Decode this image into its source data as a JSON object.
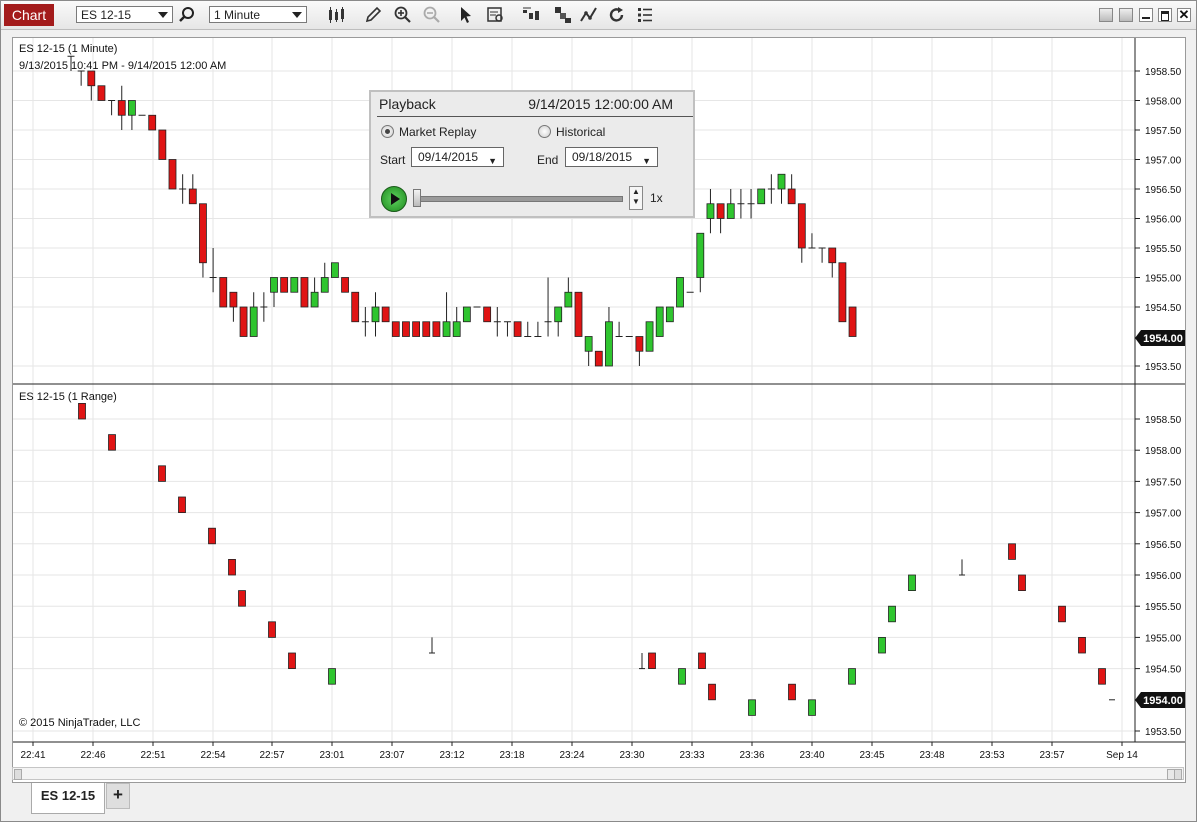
{
  "window": {
    "tab_title": "Chart",
    "instrument": "ES 12-15",
    "interval": "1 Minute"
  },
  "toolbar": {
    "icons": [
      "search-icon",
      "bar-style-icon",
      "draw-pencil-icon",
      "zoom-in-icon",
      "zoom-out-icon",
      "pointer-icon",
      "data-box-icon",
      "strategies-icon",
      "indicators-icon",
      "chart-trader-icon",
      "reload-icon",
      "properties-icon"
    ]
  },
  "colors": {
    "up": "#2fc52f",
    "down": "#e01414",
    "accent": "#a31b1b",
    "price_marker": "#111111"
  },
  "panel1": {
    "title": "ES 12-15 (1 Minute)",
    "range": "9/13/2015 10:41 PM - 9/14/2015 12:00 AM",
    "price_levels": [
      "1958.50",
      "1958.00",
      "1957.50",
      "1957.00",
      "1956.50",
      "1956.00",
      "1955.50",
      "1955.00",
      "1954.50",
      "1953.50"
    ],
    "last_price": "1954.00"
  },
  "panel2": {
    "title": "ES 12-15 (1 Range)",
    "price_levels": [
      "1958.50",
      "1958.00",
      "1957.50",
      "1957.00",
      "1956.50",
      "1956.00",
      "1955.50",
      "1955.00",
      "1954.50",
      "1953.50"
    ],
    "last_price": "1954.00",
    "copyright": "© 2015 NinjaTrader, LLC"
  },
  "time_axis": [
    "22:41",
    "22:46",
    "22:51",
    "22:54",
    "22:57",
    "23:01",
    "23:07",
    "23:12",
    "23:18",
    "23:24",
    "23:30",
    "23:33",
    "23:36",
    "23:40",
    "23:45",
    "23:48",
    "23:53",
    "23:57",
    "Sep 14"
  ],
  "playback": {
    "title": "Playback",
    "time": "9/14/2015 12:00:00 AM",
    "market_replay": "Market Replay",
    "historical": "Historical",
    "start_label": "Start",
    "start_value": "09/14/2015",
    "end_label": "End",
    "end_value": "09/18/2015",
    "speed": "1x"
  },
  "bottom_tabs": {
    "active": "ES 12-15",
    "add": "+"
  },
  "chart_data": [
    {
      "type": "candlestick",
      "title": "ES 12-15 (1 Minute)",
      "ylim": [
        1953.25,
        1959.0
      ],
      "candles": [
        {
          "o": 1958.75,
          "h": 1958.75,
          "l": 1958.5,
          "c": 1958.75
        },
        {
          "o": 1958.5,
          "h": 1958.5,
          "l": 1958.25,
          "c": 1958.5
        },
        {
          "o": 1958.5,
          "h": 1958.5,
          "l": 1958.0,
          "c": 1958.25
        },
        {
          "o": 1958.25,
          "h": 1958.25,
          "l": 1958.0,
          "c": 1958.0
        },
        {
          "o": 1958.0,
          "h": 1958.0,
          "l": 1957.75,
          "c": 1958.0
        },
        {
          "o": 1958.0,
          "h": 1958.25,
          "l": 1957.5,
          "c": 1957.75
        },
        {
          "o": 1957.75,
          "h": 1958.0,
          "l": 1957.5,
          "c": 1958.0
        },
        {
          "o": 1957.75,
          "h": 1957.75,
          "l": 1957.75,
          "c": 1957.75
        },
        {
          "o": 1957.75,
          "h": 1957.75,
          "l": 1957.5,
          "c": 1957.5
        },
        {
          "o": 1957.5,
          "h": 1957.5,
          "l": 1957.0,
          "c": 1957.0
        },
        {
          "o": 1957.0,
          "h": 1957.0,
          "l": 1956.5,
          "c": 1956.5
        },
        {
          "o": 1956.5,
          "h": 1956.75,
          "l": 1956.25,
          "c": 1956.5
        },
        {
          "o": 1956.5,
          "h": 1956.75,
          "l": 1956.25,
          "c": 1956.25
        },
        {
          "o": 1956.25,
          "h": 1956.25,
          "l": 1955.0,
          "c": 1955.25
        },
        {
          "o": 1955.0,
          "h": 1955.5,
          "l": 1954.75,
          "c": 1955.0
        },
        {
          "o": 1955.0,
          "h": 1955.0,
          "l": 1954.5,
          "c": 1954.5
        },
        {
          "o": 1954.75,
          "h": 1954.75,
          "l": 1954.25,
          "c": 1954.5
        },
        {
          "o": 1954.5,
          "h": 1954.5,
          "l": 1954.0,
          "c": 1954.0
        },
        {
          "o": 1954.0,
          "h": 1954.75,
          "l": 1954.0,
          "c": 1954.5
        },
        {
          "o": 1954.5,
          "h": 1954.75,
          "l": 1954.25,
          "c": 1954.5
        },
        {
          "o": 1954.75,
          "h": 1955.0,
          "l": 1954.5,
          "c": 1955.0
        },
        {
          "o": 1955.0,
          "h": 1955.0,
          "l": 1954.75,
          "c": 1954.75
        },
        {
          "o": 1954.75,
          "h": 1955.0,
          "l": 1954.75,
          "c": 1955.0
        },
        {
          "o": 1955.0,
          "h": 1955.0,
          "l": 1954.5,
          "c": 1954.5
        },
        {
          "o": 1954.5,
          "h": 1955.0,
          "l": 1954.5,
          "c": 1954.75
        },
        {
          "o": 1954.75,
          "h": 1955.25,
          "l": 1954.75,
          "c": 1955.0
        },
        {
          "o": 1955.0,
          "h": 1955.25,
          "l": 1955.0,
          "c": 1955.25
        },
        {
          "o": 1955.0,
          "h": 1955.0,
          "l": 1954.75,
          "c": 1954.75
        },
        {
          "o": 1954.75,
          "h": 1954.75,
          "l": 1954.25,
          "c": 1954.25
        },
        {
          "o": 1954.25,
          "h": 1954.5,
          "l": 1954.0,
          "c": 1954.25
        },
        {
          "o": 1954.25,
          "h": 1954.75,
          "l": 1954.0,
          "c": 1954.5
        },
        {
          "o": 1954.5,
          "h": 1954.5,
          "l": 1954.25,
          "c": 1954.25
        },
        {
          "o": 1954.25,
          "h": 1954.25,
          "l": 1954.0,
          "c": 1954.0
        },
        {
          "o": 1954.25,
          "h": 1954.25,
          "l": 1954.0,
          "c": 1954.0
        },
        {
          "o": 1954.25,
          "h": 1954.25,
          "l": 1954.0,
          "c": 1954.0
        },
        {
          "o": 1954.25,
          "h": 1954.25,
          "l": 1954.0,
          "c": 1954.0
        },
        {
          "o": 1954.25,
          "h": 1954.25,
          "l": 1954.0,
          "c": 1954.0
        },
        {
          "o": 1954.0,
          "h": 1954.75,
          "l": 1954.0,
          "c": 1954.25
        },
        {
          "o": 1954.0,
          "h": 1954.5,
          "l": 1954.0,
          "c": 1954.25
        },
        {
          "o": 1954.25,
          "h": 1954.5,
          "l": 1954.25,
          "c": 1954.5
        },
        {
          "o": 1954.5,
          "h": 1954.5,
          "l": 1954.5,
          "c": 1954.5
        },
        {
          "o": 1954.5,
          "h": 1954.5,
          "l": 1954.25,
          "c": 1954.25
        },
        {
          "o": 1954.25,
          "h": 1954.5,
          "l": 1954.0,
          "c": 1954.25
        },
        {
          "o": 1954.25,
          "h": 1954.25,
          "l": 1954.0,
          "c": 1954.25
        },
        {
          "o": 1954.25,
          "h": 1954.25,
          "l": 1954.0,
          "c": 1954.0
        },
        {
          "o": 1954.0,
          "h": 1954.25,
          "l": 1954.0,
          "c": 1954.0
        },
        {
          "o": 1954.0,
          "h": 1954.25,
          "l": 1954.0,
          "c": 1954.0
        },
        {
          "o": 1954.25,
          "h": 1955.0,
          "l": 1954.0,
          "c": 1954.25
        },
        {
          "o": 1954.25,
          "h": 1954.5,
          "l": 1954.0,
          "c": 1954.5
        },
        {
          "o": 1954.5,
          "h": 1955.0,
          "l": 1954.5,
          "c": 1954.75
        },
        {
          "o": 1954.75,
          "h": 1954.75,
          "l": 1954.0,
          "c": 1954.0
        },
        {
          "o": 1953.75,
          "h": 1954.0,
          "l": 1953.5,
          "c": 1954.0
        },
        {
          "o": 1953.75,
          "h": 1953.75,
          "l": 1953.5,
          "c": 1953.5
        },
        {
          "o": 1953.5,
          "h": 1954.5,
          "l": 1953.5,
          "c": 1954.25
        },
        {
          "o": 1954.0,
          "h": 1954.25,
          "l": 1954.0,
          "c": 1954.0
        },
        {
          "o": 1954.0,
          "h": 1954.0,
          "l": 1954.0,
          "c": 1954.0
        },
        {
          "o": 1954.0,
          "h": 1954.0,
          "l": 1953.5,
          "c": 1953.75
        },
        {
          "o": 1953.75,
          "h": 1954.25,
          "l": 1953.75,
          "c": 1954.25
        },
        {
          "o": 1954.0,
          "h": 1954.5,
          "l": 1954.0,
          "c": 1954.5
        },
        {
          "o": 1954.25,
          "h": 1954.5,
          "l": 1954.25,
          "c": 1954.5
        },
        {
          "o": 1954.5,
          "h": 1955.0,
          "l": 1954.5,
          "c": 1955.0
        },
        {
          "o": 1954.75,
          "h": 1954.75,
          "l": 1954.75,
          "c": 1954.75
        },
        {
          "o": 1955.0,
          "h": 1955.75,
          "l": 1954.75,
          "c": 1955.75
        },
        {
          "o": 1956.0,
          "h": 1956.5,
          "l": 1955.75,
          "c": 1956.25
        },
        {
          "o": 1956.25,
          "h": 1956.25,
          "l": 1955.75,
          "c": 1956.0
        },
        {
          "o": 1956.0,
          "h": 1956.5,
          "l": 1956.0,
          "c": 1956.25
        },
        {
          "o": 1956.25,
          "h": 1956.5,
          "l": 1956.0,
          "c": 1956.25
        },
        {
          "o": 1956.25,
          "h": 1956.5,
          "l": 1956.0,
          "c": 1956.25
        },
        {
          "o": 1956.25,
          "h": 1956.5,
          "l": 1956.25,
          "c": 1956.5
        },
        {
          "o": 1956.5,
          "h": 1956.75,
          "l": 1956.25,
          "c": 1956.5
        },
        {
          "o": 1956.5,
          "h": 1956.75,
          "l": 1956.25,
          "c": 1956.75
        },
        {
          "o": 1956.5,
          "h": 1956.75,
          "l": 1956.25,
          "c": 1956.25
        },
        {
          "o": 1956.25,
          "h": 1956.25,
          "l": 1955.25,
          "c": 1955.5
        },
        {
          "o": 1955.5,
          "h": 1955.75,
          "l": 1955.5,
          "c": 1955.5
        },
        {
          "o": 1955.5,
          "h": 1955.5,
          "l": 1955.25,
          "c": 1955.5
        },
        {
          "o": 1955.5,
          "h": 1955.5,
          "l": 1955.0,
          "c": 1955.25
        },
        {
          "o": 1955.25,
          "h": 1955.25,
          "l": 1954.25,
          "c": 1954.25
        },
        {
          "o": 1954.5,
          "h": 1954.5,
          "l": 1954.0,
          "c": 1954.0
        }
      ]
    },
    {
      "type": "candlestick",
      "title": "ES 12-15 (1 Range)",
      "ylim": [
        1953.25,
        1959.0
      ],
      "bars": [
        {
          "x": 80,
          "o": 1958.75,
          "c": 1958.5
        },
        {
          "x": 110,
          "o": 1958.25,
          "c": 1958.0
        },
        {
          "x": 160,
          "o": 1957.75,
          "c": 1957.5
        },
        {
          "x": 180,
          "o": 1957.25,
          "c": 1957.0
        },
        {
          "x": 210,
          "o": 1956.75,
          "c": 1956.5
        },
        {
          "x": 230,
          "o": 1956.25,
          "c": 1956.0
        },
        {
          "x": 240,
          "o": 1955.75,
          "c": 1955.5
        },
        {
          "x": 270,
          "o": 1955.25,
          "c": 1955.0
        },
        {
          "x": 290,
          "o": 1954.75,
          "c": 1954.5
        },
        {
          "x": 330,
          "o": 1954.25,
          "c": 1954.5
        },
        {
          "x": 430,
          "o": 1955.0,
          "c": 1954.75,
          "doji": true
        },
        {
          "x": 640,
          "o": 1954.75,
          "c": 1954.5,
          "doji": true
        },
        {
          "x": 650,
          "o": 1954.75,
          "c": 1954.5
        },
        {
          "x": 680,
          "o": 1954.25,
          "c": 1954.5
        },
        {
          "x": 700,
          "o": 1954.75,
          "c": 1954.5
        },
        {
          "x": 710,
          "o": 1954.25,
          "c": 1954.0
        },
        {
          "x": 750,
          "o": 1953.75,
          "c": 1954.0
        },
        {
          "x": 790,
          "o": 1954.25,
          "c": 1954.0
        },
        {
          "x": 810,
          "o": 1953.75,
          "c": 1954.0
        },
        {
          "x": 850,
          "o": 1954.25,
          "c": 1954.5
        },
        {
          "x": 880,
          "o": 1954.75,
          "c": 1955.0
        },
        {
          "x": 890,
          "o": 1955.25,
          "c": 1955.5
        },
        {
          "x": 910,
          "o": 1955.75,
          "c": 1956.0
        },
        {
          "x": 960,
          "o": 1956.25,
          "c": 1956.0,
          "doji": true
        },
        {
          "x": 1010,
          "o": 1956.5,
          "c": 1956.25
        },
        {
          "x": 1020,
          "o": 1956.0,
          "c": 1955.75
        },
        {
          "x": 1060,
          "o": 1955.5,
          "c": 1955.25
        },
        {
          "x": 1080,
          "o": 1955.0,
          "c": 1954.75
        },
        {
          "x": 1100,
          "o": 1954.5,
          "c": 1954.25
        },
        {
          "x": 1110,
          "o": 1954.0,
          "c": 1954.0,
          "doji": true
        }
      ]
    }
  ]
}
